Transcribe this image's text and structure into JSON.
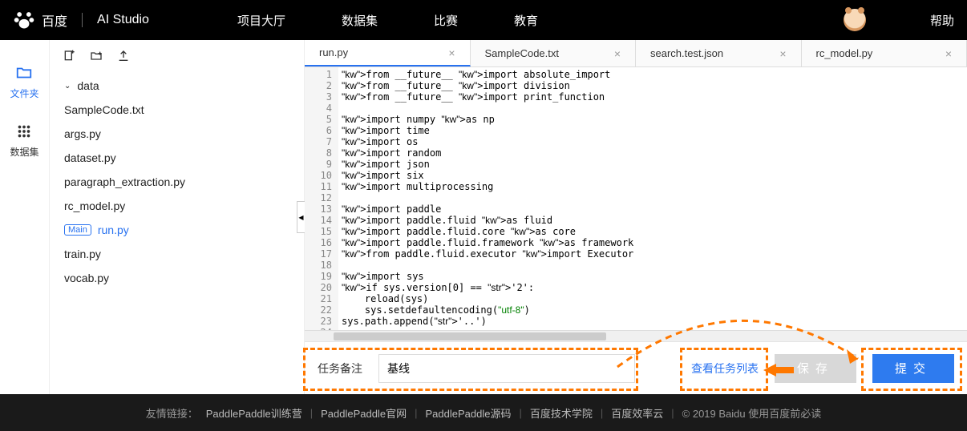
{
  "header": {
    "logo_baidu": "百度",
    "logo_studio": "AI Studio",
    "nav": [
      "项目大厅",
      "数据集",
      "比赛",
      "教育"
    ],
    "help": "帮助"
  },
  "sidebar": {
    "files": {
      "label": "文件夹"
    },
    "datasets": {
      "label": "数据集"
    }
  },
  "file_tree": {
    "root": "data",
    "items": [
      "SampleCode.txt",
      "args.py",
      "dataset.py",
      "paragraph_extraction.py",
      "rc_model.py",
      "run.py",
      "train.py",
      "vocab.py"
    ],
    "main_badge": "Main",
    "active": "run.py"
  },
  "tabs": [
    {
      "label": "run.py",
      "active": true
    },
    {
      "label": "SampleCode.txt",
      "active": false
    },
    {
      "label": "search.test.json",
      "active": false
    },
    {
      "label": "rc_model.py",
      "active": false
    }
  ],
  "code": {
    "lines": [
      "from __future__ import absolute_import",
      "from __future__ import division",
      "from __future__ import print_function",
      "",
      "import numpy as np",
      "import time",
      "import os",
      "import random",
      "import json",
      "import six",
      "import multiprocessing",
      "",
      "import paddle",
      "import paddle.fluid as fluid",
      "import paddle.fluid.core as core",
      "import paddle.fluid.framework as framework",
      "from paddle.fluid.executor import Executor",
      "",
      "import sys",
      "if sys.version[0] == '2':",
      "    reload(sys)",
      "    sys.setdefaultencoding(\"utf-8\")",
      "sys.path.append('..')",
      ""
    ]
  },
  "bottom": {
    "task_label": "任务备注",
    "task_value": "基线",
    "view_list": "查看任务列表",
    "save": "保存",
    "submit": "提交"
  },
  "footer": {
    "prefix": "友情链接：",
    "links": [
      "PaddlePaddle训练营",
      "PaddlePaddle官网",
      "PaddlePaddle源码",
      "百度技术学院",
      "百度效率云"
    ],
    "copyright": "© 2019 Baidu 使用百度前必读"
  }
}
